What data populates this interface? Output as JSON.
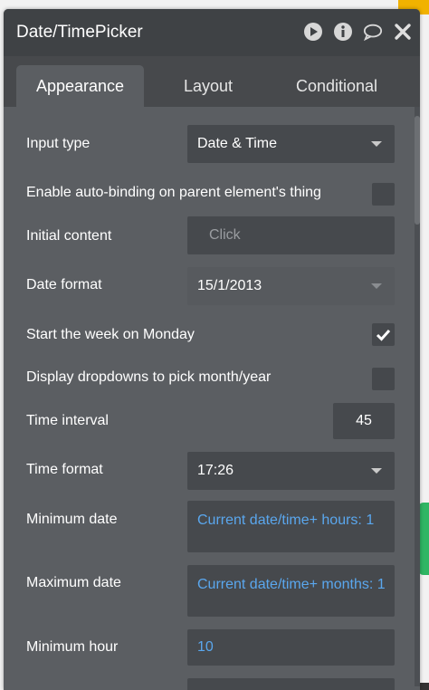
{
  "window": {
    "title": "Date/TimePicker"
  },
  "title_icons": [
    "play-icon",
    "info-icon",
    "comment-icon",
    "close-icon"
  ],
  "tabs": [
    {
      "label": "Appearance",
      "active": true
    },
    {
      "label": "Layout",
      "active": false
    },
    {
      "label": "Conditional",
      "active": false
    }
  ],
  "fields": {
    "input_type": {
      "label": "Input type",
      "value": "Date & Time"
    },
    "auto_binding": {
      "label": "Enable auto-binding on parent element's thing",
      "checked": false
    },
    "initial_content": {
      "label": "Initial content",
      "placeholder": "Click"
    },
    "date_format": {
      "label": "Date format",
      "value": "15/1/2013"
    },
    "start_monday": {
      "label": "Start the week on Monday",
      "checked": true
    },
    "dropdowns": {
      "label": "Display dropdowns to pick month/year",
      "checked": false
    },
    "time_interval": {
      "label": "Time interval",
      "value": "45"
    },
    "time_format": {
      "label": "Time format",
      "value": "17:26"
    },
    "minimum_date": {
      "label": "Minimum date",
      "value": "Current date/time+ hours: 1"
    },
    "maximum_date": {
      "label": "Maximum date",
      "value": "Current date/time+ months: 1"
    },
    "minimum_hour": {
      "label": "Minimum hour",
      "value": "10"
    }
  },
  "colors": {
    "panel": "#5b5e62",
    "titlebar": "#3f4245",
    "field": "#46494d",
    "dynamic_text": "#5aa7ee"
  }
}
